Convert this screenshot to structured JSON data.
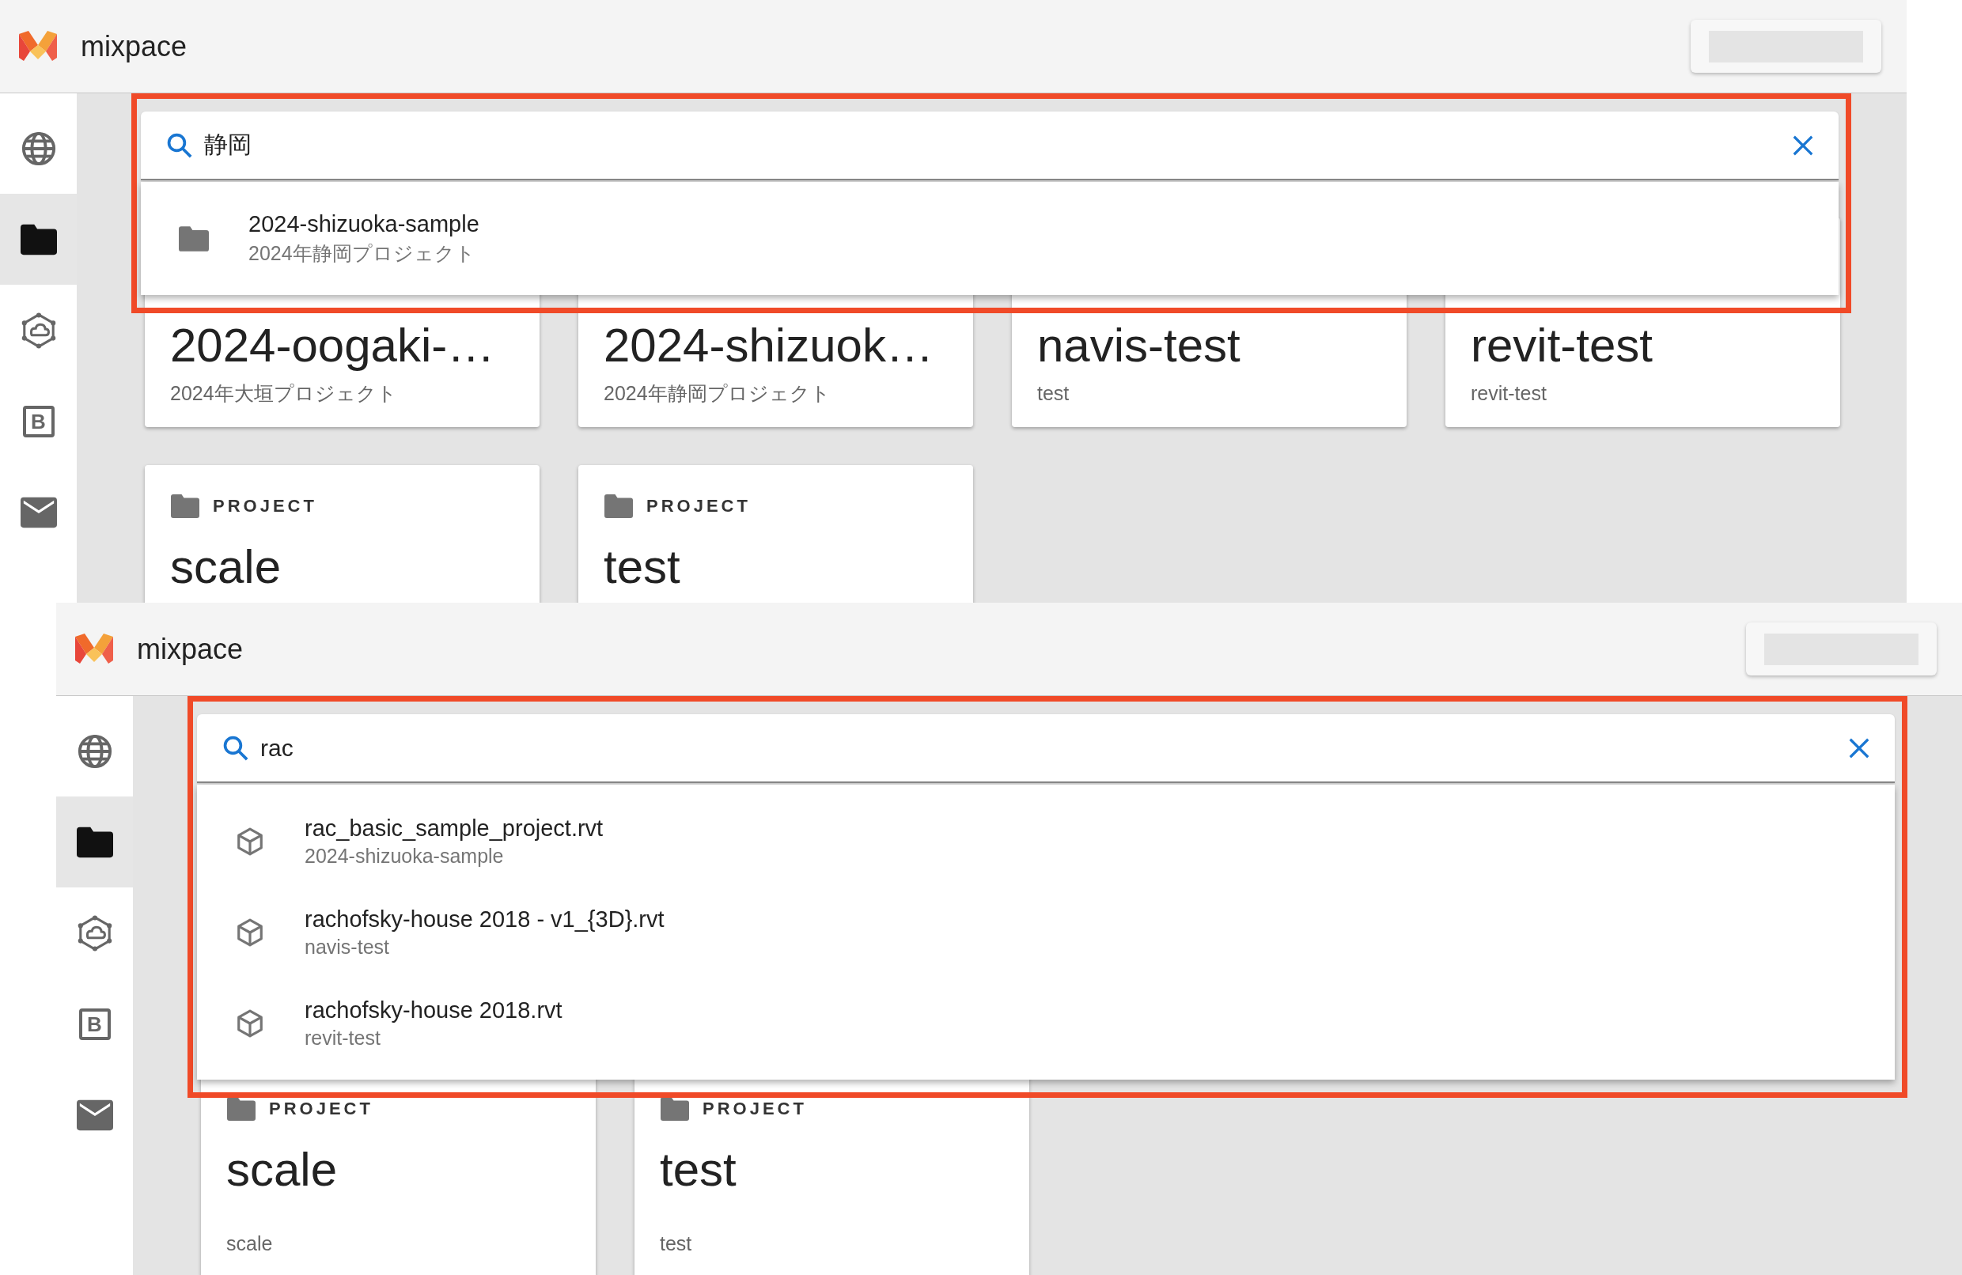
{
  "screens": [
    {
      "app_name": "mixpace",
      "sidebar": [
        {
          "kind": "globe",
          "selected": false
        },
        {
          "kind": "folder",
          "selected": true
        },
        {
          "kind": "cloud",
          "selected": false
        },
        {
          "kind": "letter",
          "glyph": "B",
          "selected": false
        },
        {
          "kind": "mail",
          "selected": false
        }
      ],
      "search": {
        "value": "静岡"
      },
      "results": [
        {
          "kind": "project",
          "title": "2024-shizuoka-sample",
          "subtitle": "2024年静岡プロジェクト"
        }
      ],
      "cards": [
        {
          "title": "2024-oogaki-…",
          "subtitle": "2024年大垣プロジェクト"
        },
        {
          "title": "2024-shizuok…",
          "subtitle": "2024年静岡プロジェクト"
        },
        {
          "title": "navis-test",
          "subtitle": "test"
        },
        {
          "title": "revit-test",
          "subtitle": "revit-test"
        },
        {
          "label": "PROJECT",
          "title": "scale"
        },
        {
          "label": "PROJECT",
          "title": "test"
        }
      ]
    },
    {
      "app_name": "mixpace",
      "sidebar": [
        {
          "kind": "globe",
          "selected": false
        },
        {
          "kind": "folder",
          "selected": true
        },
        {
          "kind": "cloud",
          "selected": false
        },
        {
          "kind": "letter",
          "glyph": "B",
          "selected": false
        },
        {
          "kind": "mail",
          "selected": false
        }
      ],
      "search": {
        "value": "rac"
      },
      "results": [
        {
          "kind": "model",
          "title": "rac_basic_sample_project.rvt",
          "subtitle": "2024-shizuoka-sample"
        },
        {
          "kind": "model",
          "title": "rachofsky-house 2018 - v1_{3D}.rvt",
          "subtitle": "navis-test"
        },
        {
          "kind": "model",
          "title": "rachofsky-house 2018.rvt",
          "subtitle": "revit-test"
        }
      ],
      "cards": [
        {
          "label": "PROJECT",
          "title": "scale",
          "subtitle": "scale"
        },
        {
          "label": "PROJECT",
          "title": "test",
          "subtitle": "test"
        }
      ]
    }
  ]
}
